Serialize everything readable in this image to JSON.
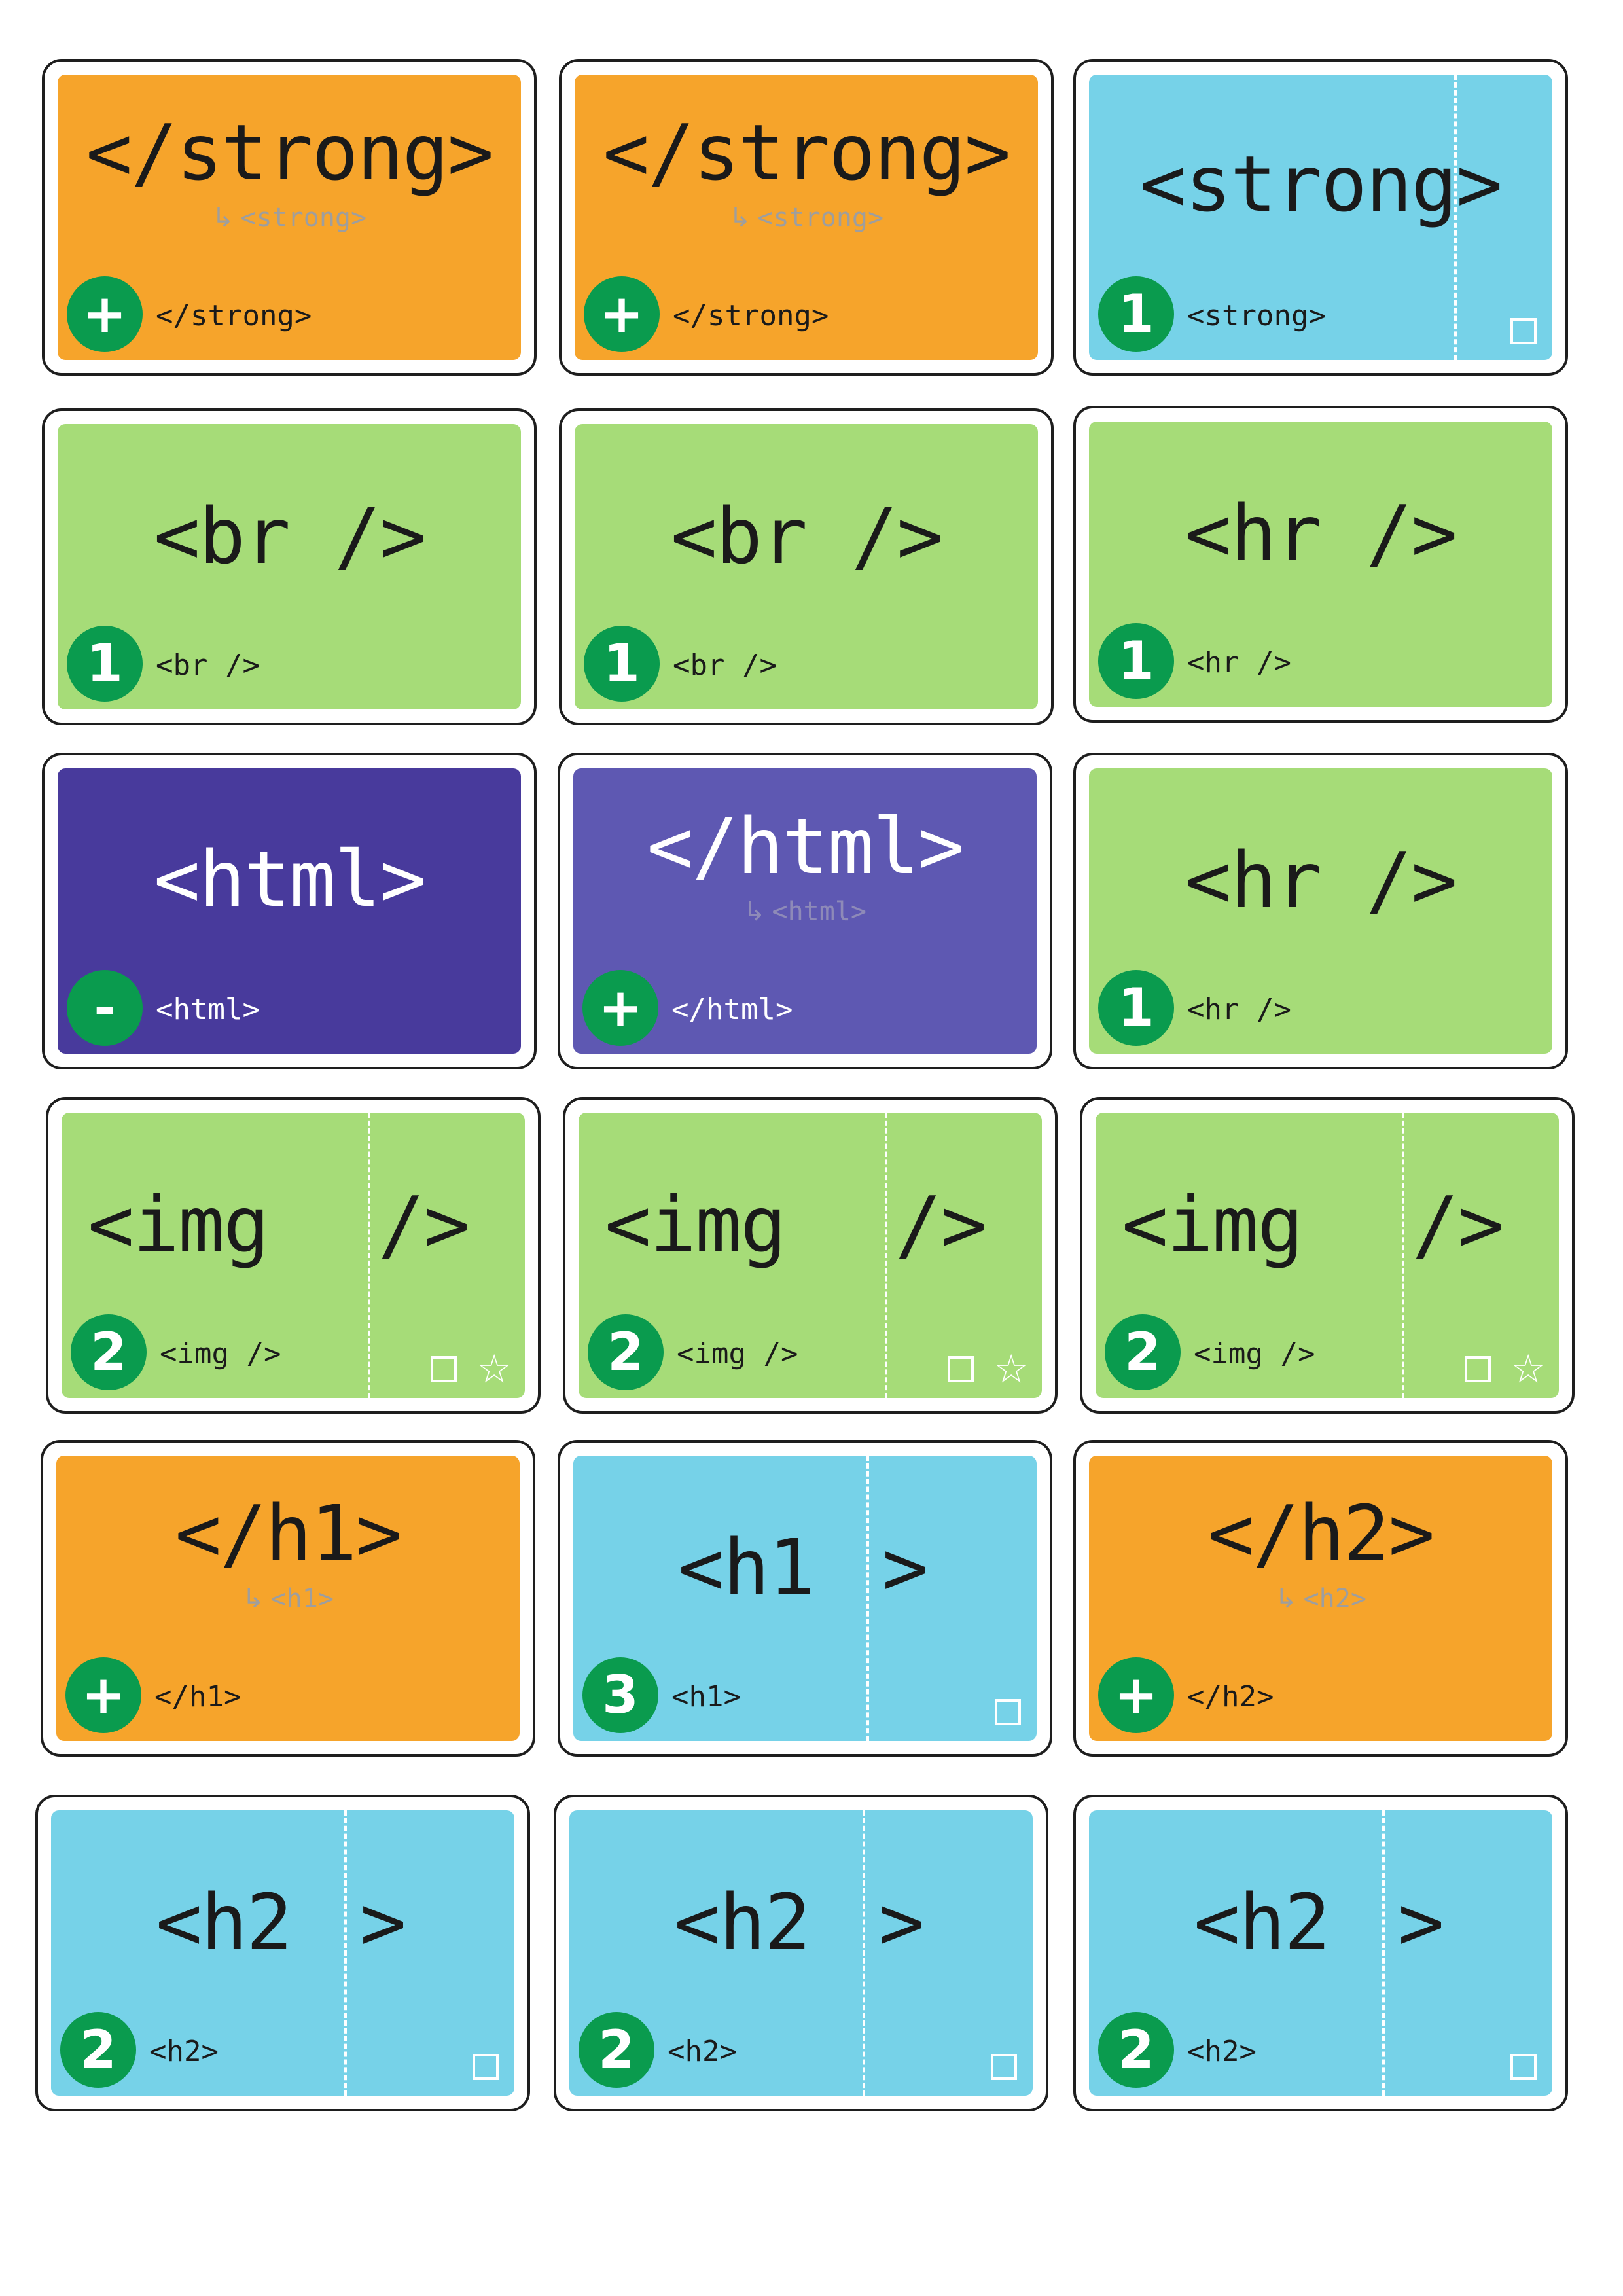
{
  "cards": [
    {
      "big": "</strong>",
      "hint_arrow": "↳",
      "hint": "<strong>",
      "badge": "+",
      "small": "</strong>"
    },
    {
      "big": "</strong>",
      "hint_arrow": "↳",
      "hint": "<strong>",
      "badge": "+",
      "small": "</strong>"
    },
    {
      "big": "<strong>",
      "badge": "1",
      "small": "<strong>"
    },
    {
      "big": "<br />",
      "badge": "1",
      "small": "<br />"
    },
    {
      "big": "<br />",
      "badge": "1",
      "small": "<br />"
    },
    {
      "big": "<hr />",
      "badge": "1",
      "small": "<hr />"
    },
    {
      "big": "<html>",
      "badge": "-",
      "small": "<html>"
    },
    {
      "big": "</html>",
      "hint_arrow": "↳",
      "hint": "<html>",
      "badge": "+",
      "small": "</html>"
    },
    {
      "big": "<hr />",
      "badge": "1",
      "small": "<hr />"
    },
    {
      "big_left": "<img",
      "big_right": "/>",
      "badge": "2",
      "small": "<img />",
      "star": "☆"
    },
    {
      "big_left": "<img",
      "big_right": "/>",
      "badge": "2",
      "small": "<img />",
      "star": "☆"
    },
    {
      "big_left": "<img",
      "big_right": "/>",
      "badge": "2",
      "small": "<img />",
      "star": "☆"
    },
    {
      "big": "</h1>",
      "hint_arrow": "↳",
      "hint": "<h1>",
      "badge": "+",
      "small": "</h1>"
    },
    {
      "big_left": "<h1",
      "big_right": ">",
      "badge": "3",
      "small": "<h1>"
    },
    {
      "big": "</h2>",
      "hint_arrow": "↳",
      "hint": "<h2>",
      "badge": "+",
      "small": "</h2>"
    },
    {
      "big_left": "<h2",
      "big_right": ">",
      "badge": "2",
      "small": "<h2>"
    },
    {
      "big_left": "<h2",
      "big_right": ">",
      "badge": "2",
      "small": "<h2>"
    },
    {
      "big_left": "<h2",
      "big_right": ">",
      "badge": "2",
      "small": "<h2>"
    }
  ],
  "colors": {
    "orange": "#f6a42b",
    "blue": "#76d2e8",
    "green": "#a6dc78",
    "purple_dark": "#483a9c",
    "purple_light": "#5e58b2",
    "badge_green": "#0a9b4e"
  }
}
